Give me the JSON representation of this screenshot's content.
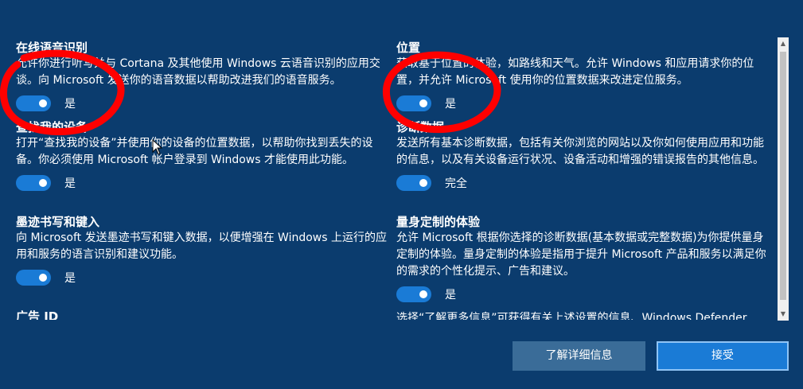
{
  "left_column": {
    "speech": {
      "title": "在线语音识别",
      "desc": "允许你进行听写并与 Cortana 及其他使用 Windows 云语音识别的应用交谈。向 Microsoft 发送你的语音数据以帮助改进我们的语音服务。",
      "toggle_label": "是"
    },
    "find_device": {
      "title": "查找我的设备",
      "desc": "打开“查找我的设备”并使用你的设备的位置数据，以帮助你找到丢失的设备。你必须使用 Microsoft 帐户登录到 Windows 才能使用此功能。",
      "toggle_label": "是"
    },
    "inking": {
      "title": "墨迹书写和键入",
      "desc": "向 Microsoft 发送墨迹书写和键入数据，以便增强在 Windows 上运行的应用和服务的语言识别和建议功能。",
      "toggle_label": "是"
    },
    "ad_id": {
      "title": "广告 ID"
    }
  },
  "right_column": {
    "location": {
      "title": "位置",
      "desc": "获取基于位置的体验，如路线和天气。允许 Windows 和应用请求你的位置，并允许 Microsoft 使用你的位置数据来改进定位服务。",
      "toggle_label": "是"
    },
    "diagnostics": {
      "title": "诊断数据",
      "desc": "发送所有基本诊断数据，包括有关你浏览的网站以及你如何使用应用和功能的信息，以及有关设备运行状况、设备活动和增强的错误报告的其他信息。",
      "toggle_label": "完全"
    },
    "tailored": {
      "title": "量身定制的体验",
      "desc": "允许 Microsoft 根据你选择的诊断数据(基本数据或完整数据)为你提供量身定制的体验。量身定制的体验是指用于提升 Microsoft 产品和服务以满足你的需求的个性化提示、广告和建议。",
      "toggle_label": "是"
    },
    "footer_note": "选择“了解更多信息”可获得有关上述设置的信息、Windows Defender"
  },
  "buttons": {
    "learn_more": "了解详细信息",
    "accept": "接受"
  },
  "toggles": {
    "speech": 1,
    "find_device": 1,
    "inking": 1,
    "location": 1,
    "diagnostics": 1,
    "tailored": 1
  },
  "colors": {
    "background": "#0b3c6e",
    "toggle_on": "#1a7bd6",
    "annotation": "#ff0000",
    "accept_button": "#1a7bd6",
    "learn_button": "#3a6c98"
  },
  "icons": {
    "scroll_up": "chevron-up-icon",
    "scroll_down": "chevron-down-icon",
    "cursor": "mouse-pointer-icon"
  }
}
